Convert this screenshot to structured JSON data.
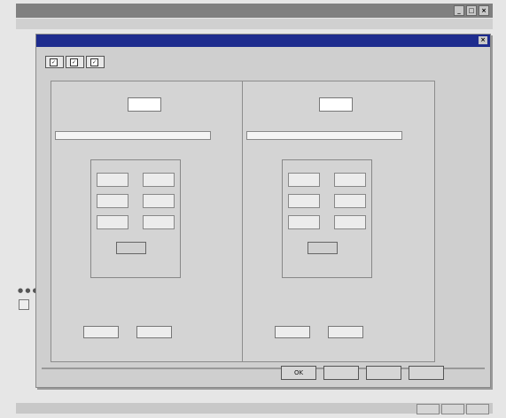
{
  "window": {
    "title": "",
    "controls": [
      "_",
      "□",
      "×"
    ]
  },
  "menubar": {
    "items": [
      "",
      "",
      "",
      ""
    ],
    "right": ""
  },
  "dialog": {
    "title": "",
    "close": "×",
    "tabs": [
      {
        "label": "",
        "checked": true
      },
      {
        "label": "",
        "checked": true
      },
      {
        "label": "",
        "checked": true
      }
    ]
  },
  "panels": [
    {
      "caption": "",
      "select_label": "",
      "name_value": "",
      "group_caption": "",
      "left_label": "",
      "right_label": ""
    },
    {
      "caption": "",
      "select_label": "",
      "name_value": "",
      "group_caption": "",
      "left_label": "",
      "right_label": ""
    }
  ],
  "buttons": {
    "ok": "OK",
    "b2": "",
    "b3": "",
    "b4": ""
  },
  "colors": {
    "titlebar": "#1e2c8e",
    "outer_titlebar": "#808080",
    "dialog_bg": "#cfcfcf"
  }
}
